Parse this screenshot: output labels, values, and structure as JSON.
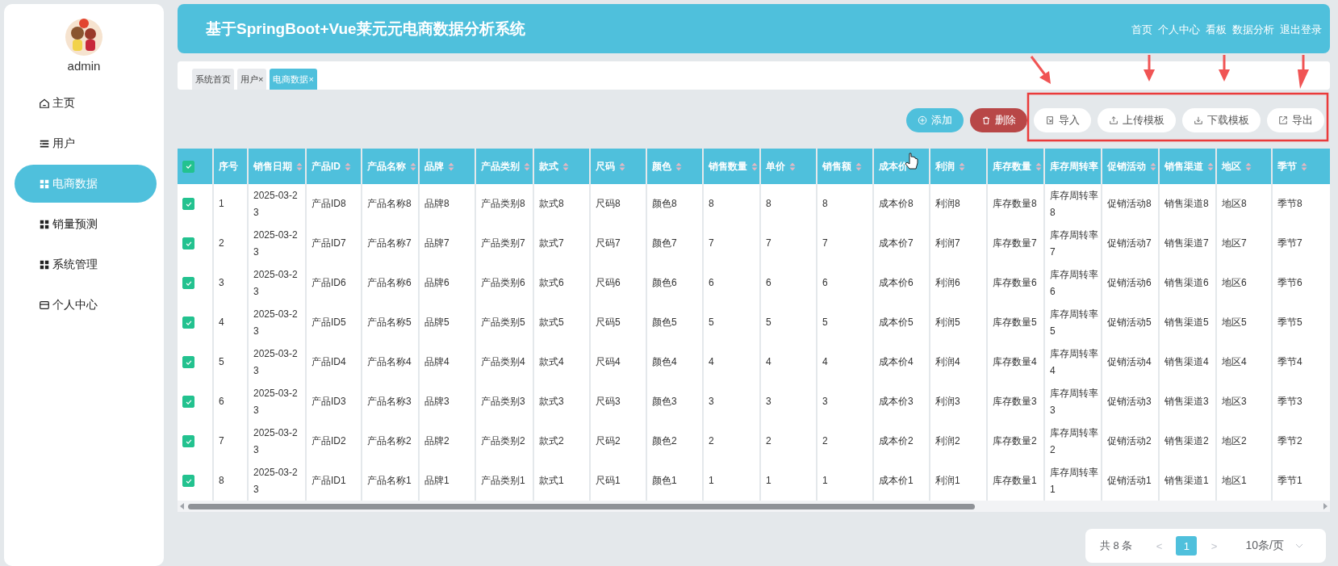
{
  "sidebar": {
    "user": "admin",
    "items": [
      {
        "label": "主页",
        "selected": false
      },
      {
        "label": "用户",
        "selected": false
      },
      {
        "label": "电商数据",
        "selected": true
      },
      {
        "label": "销量预测",
        "selected": false
      },
      {
        "label": "系统管理",
        "selected": false
      },
      {
        "label": "个人中心",
        "selected": false
      }
    ]
  },
  "header": {
    "title": "基于SpringBoot+Vue莱元元电商数据分析系统",
    "links": [
      "首页",
      "个人中心",
      "看板",
      "数据分析",
      "退出登录"
    ]
  },
  "tabs": [
    {
      "label": "系统首页",
      "selected": false
    },
    {
      "label": "用户",
      "close": "×",
      "selected": false
    },
    {
      "label": "电商数据",
      "close": "×",
      "selected": true
    }
  ],
  "toolbar": [
    {
      "label": "添加",
      "kind": "primary"
    },
    {
      "label": "删除",
      "kind": "danger"
    },
    {
      "label": "导入",
      "kind": "plain"
    },
    {
      "label": "上传模板",
      "kind": "plain"
    },
    {
      "label": "下载模板",
      "kind": "plain"
    },
    {
      "label": "导出",
      "kind": "plain"
    }
  ],
  "table": {
    "all_checked": true,
    "columns": [
      {
        "label": "序号",
        "sortable": false
      },
      {
        "label": "销售日期",
        "sortable": true
      },
      {
        "label": "产品ID",
        "sortable": true
      },
      {
        "label": "产品名称",
        "sortable": true
      },
      {
        "label": "品牌",
        "sortable": true
      },
      {
        "label": "产品类别",
        "sortable": true
      },
      {
        "label": "款式",
        "sortable": true
      },
      {
        "label": "尺码",
        "sortable": true
      },
      {
        "label": "颜色",
        "sortable": true
      },
      {
        "label": "销售数量",
        "sortable": true
      },
      {
        "label": "单价",
        "sortable": true
      },
      {
        "label": "销售额",
        "sortable": true
      },
      {
        "label": "成本价",
        "sortable": false
      },
      {
        "label": "利润",
        "sortable": true
      },
      {
        "label": "库存数量",
        "sortable": true
      },
      {
        "label": "库存周转率",
        "sortable": false
      },
      {
        "label": "促销活动",
        "sortable": true
      },
      {
        "label": "销售渠道",
        "sortable": true
      },
      {
        "label": "地区",
        "sortable": true
      },
      {
        "label": "季节",
        "sortable": true
      }
    ],
    "rows": [
      {
        "checked": true,
        "cells": [
          "1",
          "2025-03-23",
          "产品ID8",
          "产品名称8",
          "品牌8",
          "产品类别8",
          "款式8",
          "尺码8",
          "颜色8",
          "8",
          "8",
          "8",
          "成本价8",
          "利润8",
          "库存数量8",
          "库存周转率8",
          "促销活动8",
          "销售渠道8",
          "地区8",
          "季节8"
        ]
      },
      {
        "checked": true,
        "cells": [
          "2",
          "2025-03-23",
          "产品ID7",
          "产品名称7",
          "品牌7",
          "产品类别7",
          "款式7",
          "尺码7",
          "颜色7",
          "7",
          "7",
          "7",
          "成本价7",
          "利润7",
          "库存数量7",
          "库存周转率7",
          "促销活动7",
          "销售渠道7",
          "地区7",
          "季节7"
        ]
      },
      {
        "checked": true,
        "cells": [
          "3",
          "2025-03-23",
          "产品ID6",
          "产品名称6",
          "品牌6",
          "产品类别6",
          "款式6",
          "尺码6",
          "颜色6",
          "6",
          "6",
          "6",
          "成本价6",
          "利润6",
          "库存数量6",
          "库存周转率6",
          "促销活动6",
          "销售渠道6",
          "地区6",
          "季节6"
        ]
      },
      {
        "checked": true,
        "cells": [
          "4",
          "2025-03-23",
          "产品ID5",
          "产品名称5",
          "品牌5",
          "产品类别5",
          "款式5",
          "尺码5",
          "颜色5",
          "5",
          "5",
          "5",
          "成本价5",
          "利润5",
          "库存数量5",
          "库存周转率5",
          "促销活动5",
          "销售渠道5",
          "地区5",
          "季节5"
        ]
      },
      {
        "checked": true,
        "cells": [
          "5",
          "2025-03-23",
          "产品ID4",
          "产品名称4",
          "品牌4",
          "产品类别4",
          "款式4",
          "尺码4",
          "颜色4",
          "4",
          "4",
          "4",
          "成本价4",
          "利润4",
          "库存数量4",
          "库存周转率4",
          "促销活动4",
          "销售渠道4",
          "地区4",
          "季节4"
        ]
      },
      {
        "checked": true,
        "cells": [
          "6",
          "2025-03-23",
          "产品ID3",
          "产品名称3",
          "品牌3",
          "产品类别3",
          "款式3",
          "尺码3",
          "颜色3",
          "3",
          "3",
          "3",
          "成本价3",
          "利润3",
          "库存数量3",
          "库存周转率3",
          "促销活动3",
          "销售渠道3",
          "地区3",
          "季节3"
        ]
      },
      {
        "checked": true,
        "cells": [
          "7",
          "2025-03-23",
          "产品ID2",
          "产品名称2",
          "品牌2",
          "产品类别2",
          "款式2",
          "尺码2",
          "颜色2",
          "2",
          "2",
          "2",
          "成本价2",
          "利润2",
          "库存数量2",
          "库存周转率2",
          "促销活动2",
          "销售渠道2",
          "地区2",
          "季节2"
        ]
      },
      {
        "checked": true,
        "cells": [
          "8",
          "2025-03-23",
          "产品ID1",
          "产品名称1",
          "品牌1",
          "产品类别1",
          "款式1",
          "尺码1",
          "颜色1",
          "1",
          "1",
          "1",
          "成本价1",
          "利润1",
          "库存数量1",
          "库存周转率1",
          "促销活动1",
          "销售渠道1",
          "地区1",
          "季节1"
        ]
      }
    ]
  },
  "pagination": {
    "total": "共 8 条",
    "prev": "<",
    "pages": [
      {
        "label": "1",
        "selected": true
      }
    ],
    "next": ">",
    "page_size": "10条/页"
  }
}
